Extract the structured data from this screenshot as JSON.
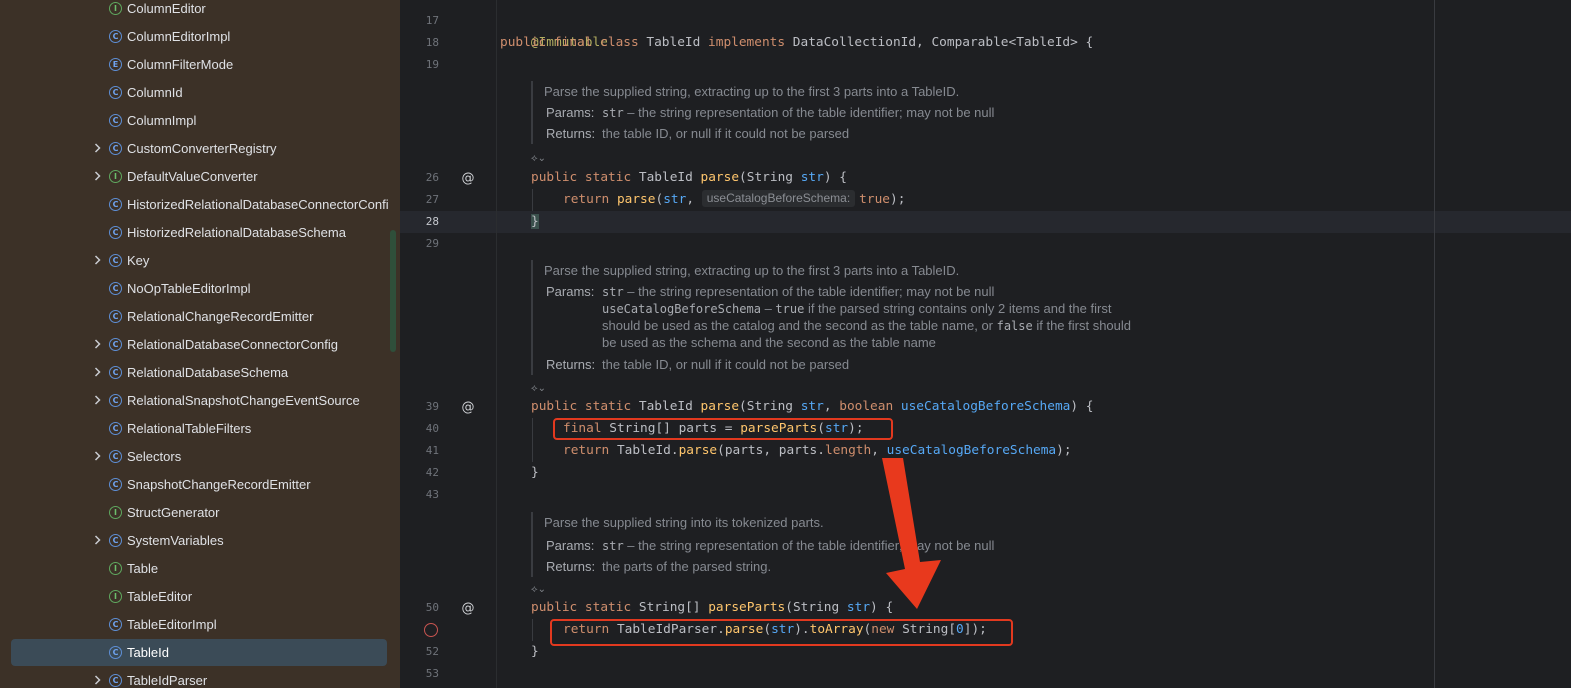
{
  "sidebar": {
    "items": [
      {
        "label": "ColumnEditor",
        "kind": "interface",
        "expandable": false
      },
      {
        "label": "ColumnEditorImpl",
        "kind": "class",
        "expandable": false
      },
      {
        "label": "ColumnFilterMode",
        "kind": "enum",
        "expandable": false
      },
      {
        "label": "ColumnId",
        "kind": "class",
        "expandable": false
      },
      {
        "label": "ColumnImpl",
        "kind": "class",
        "expandable": false
      },
      {
        "label": "CustomConverterRegistry",
        "kind": "class",
        "expandable": true
      },
      {
        "label": "DefaultValueConverter",
        "kind": "interface",
        "expandable": true
      },
      {
        "label": "HistorizedRelationalDatabaseConnectorConfi",
        "kind": "class",
        "expandable": false
      },
      {
        "label": "HistorizedRelationalDatabaseSchema",
        "kind": "class",
        "expandable": false
      },
      {
        "label": "Key",
        "kind": "class",
        "expandable": true
      },
      {
        "label": "NoOpTableEditorImpl",
        "kind": "class",
        "expandable": false
      },
      {
        "label": "RelationalChangeRecordEmitter",
        "kind": "class",
        "expandable": false
      },
      {
        "label": "RelationalDatabaseConnectorConfig",
        "kind": "class",
        "expandable": true
      },
      {
        "label": "RelationalDatabaseSchema",
        "kind": "class",
        "expandable": true
      },
      {
        "label": "RelationalSnapshotChangeEventSource",
        "kind": "class",
        "expandable": true
      },
      {
        "label": "RelationalTableFilters",
        "kind": "class",
        "expandable": false
      },
      {
        "label": "Selectors",
        "kind": "class",
        "expandable": true
      },
      {
        "label": "SnapshotChangeRecordEmitter",
        "kind": "class",
        "expandable": false
      },
      {
        "label": "StructGenerator",
        "kind": "interface",
        "expandable": false
      },
      {
        "label": "SystemVariables",
        "kind": "class",
        "expandable": true
      },
      {
        "label": "Table",
        "kind": "interface",
        "expandable": false
      },
      {
        "label": "TableEditor",
        "kind": "interface",
        "expandable": false
      },
      {
        "label": "TableEditorImpl",
        "kind": "class",
        "expandable": false
      },
      {
        "label": "TableId",
        "kind": "class",
        "expandable": false,
        "selected": true
      },
      {
        "label": "TableIdParser",
        "kind": "class",
        "expandable": true
      }
    ]
  },
  "editor": {
    "line_numbers": [
      "17",
      "18",
      "19",
      "26",
      "27",
      "28",
      "29",
      "39",
      "40",
      "41",
      "42",
      "43",
      "50",
      "52",
      "53"
    ],
    "active_line": "28",
    "code": {
      "l17": "@Immutable",
      "l18": {
        "t1": "public final class ",
        "t2": "TableId ",
        "t3": "implements ",
        "t4": "DataCollectionId, Comparable<TableId> {"
      },
      "l26": {
        "t1": "public static ",
        "t2": "TableId ",
        "t3": "parse",
        "t4": "(String ",
        "t5": "str",
        "t6": ") {"
      },
      "l27": {
        "t1": "return ",
        "t2": "parse",
        "t3": "(",
        "t4": "str",
        "t5": ", ",
        "hint": "useCatalogBeforeSchema:",
        "t6": "true",
        "t7": ");"
      },
      "l28": "}",
      "l39": {
        "t1": "public static ",
        "t2": "TableId ",
        "t3": "parse",
        "t4": "(String ",
        "t5": "str",
        "t6": ", ",
        "t7": "boolean ",
        "t8": "useCatalogBeforeSchema",
        "t9": ") {"
      },
      "l40": {
        "t1": "final ",
        "t2": "String[] parts = ",
        "t3": "parseParts",
        "t4": "(",
        "t5": "str",
        "t6": ");"
      },
      "l41": {
        "t1": "return ",
        "t2": "TableId.",
        "t3": "parse",
        "t4": "(parts, parts.",
        "t5": "length",
        "t6": ", ",
        "t7": "useCatalogBeforeSchema",
        "t8": ");"
      },
      "l42": "}",
      "l50": {
        "t1": "public static ",
        "t2": "String[] ",
        "t3": "parseParts",
        "t4": "(String ",
        "t5": "str",
        "t6": ") {"
      },
      "l51": {
        "t1": "return ",
        "t2": "TableIdParser.",
        "t3": "parse",
        "t4": "(",
        "t5": "str",
        "t6": ").",
        "t7": "toArray",
        "t8": "(",
        "t9": "new ",
        "t10": "String[",
        "t11": "0",
        "t12": "]);"
      },
      "l52": "}"
    },
    "docs": {
      "d1": {
        "summary": "Parse the supplied string, extracting up to the first 3 parts into a TableID.",
        "params_key": "Params:",
        "params_mono": "str",
        "params_text": " – the string representation of the table identifier; may not be null",
        "returns_key": "Returns:",
        "returns_text": "the table ID, or null if it could not be parsed"
      },
      "d2": {
        "summary": "Parse the supplied string, extracting up to the first 3 parts into a TableID.",
        "params_key": "Params:",
        "p1_mono": "str",
        "p1_text": " – the string representation of the table identifier; may not be null",
        "p2_mono": "useCatalogBeforeSchema",
        "p2_text_a": " – ",
        "p2_mono_true": "true",
        "p2_text_b": " if the parsed string contains only 2 items and the first",
        "p2_line2a": "should be used as the catalog and the second as the table name, or ",
        "p2_mono_false": "false",
        "p2_line2b": " if the first should",
        "p2_line3": "be used as the schema and the second as the table name",
        "returns_key": "Returns:",
        "returns_text": "the table ID, or null if it could not be parsed"
      },
      "d3": {
        "summary": "Parse the supplied string into its tokenized parts.",
        "params_key": "Params:",
        "params_mono": "str",
        "params_text": " – the string representation of the table identifier; may not be null",
        "returns_key": "Returns:",
        "returns_text": "the parts of the parsed string."
      }
    },
    "gutter_symbol": "@",
    "doc_toggle_symbol": "⟡⌄"
  },
  "colors": {
    "sidebar_bg": "#3c3127",
    "editor_bg": "#1e1f22",
    "keyword": "#cf8e6d",
    "annotation_red": "#e2391f",
    "selected_row": "#3b4b57"
  }
}
